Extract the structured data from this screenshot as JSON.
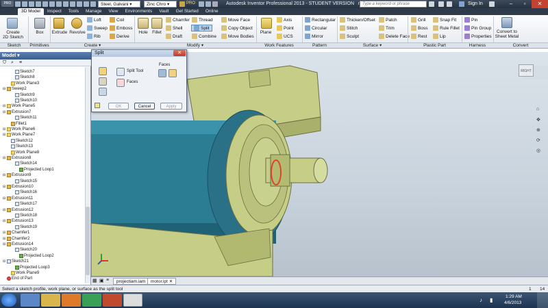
{
  "titlebar": {
    "material": "Steel, Galvani",
    "appearance": "Zinc Chro",
    "window_title": "Autodesk Inventor Professional 2013 - STUDENT VERSION",
    "file_name": "motor",
    "search_placeholder": "Type a keyword or phrase",
    "sign_in": "Sign In",
    "pro_label": "PRO"
  },
  "tabs": [
    "3D Model",
    "Inspect",
    "Tools",
    "Manage",
    "View",
    "Environments",
    "Vault",
    "Get Started",
    "Online"
  ],
  "ribbon": {
    "sketch": {
      "create_label": "Create",
      "create_sub": "2D Sketch",
      "panel": "Sketch"
    },
    "primitives": {
      "box": "Box",
      "panel": "Primitives"
    },
    "create": {
      "extrude": "Extrude",
      "revolve": "Revolve",
      "loft": "Loft",
      "sweep": "Sweep",
      "rib": "Rib",
      "coil": "Coil",
      "emboss": "Emboss",
      "derive": "Derive",
      "panel": "Create"
    },
    "modify": {
      "hole": "Hole",
      "fillet": "Fillet",
      "chamfer": "Chamfer",
      "shell": "Shell",
      "draft": "Draft",
      "thread": "Thread",
      "split": "Split",
      "combine": "Combine",
      "move_face": "Move Face",
      "copy_object": "Copy Object",
      "move_bodies": "Move Bodies",
      "panel": "Modify"
    },
    "work_features": {
      "plane": "Plane",
      "axis": "Axis",
      "point": "Point",
      "ucs": "UCS",
      "panel": "Work Features"
    },
    "pattern": {
      "rectangular": "Rectangular",
      "circular": "Circular",
      "mirror": "Mirror",
      "panel": "Pattern"
    },
    "surface": {
      "thicken": "Thicken/Offset",
      "stitch": "Stitch",
      "sculpt": "Sculpt",
      "patch": "Patch",
      "trim": "Trim",
      "delete_face": "Delete Face",
      "panel": "Surface"
    },
    "plastic_part": {
      "grill": "Grill",
      "boss": "Boss",
      "rest": "Rest",
      "snap_fit": "Snap Fit",
      "rule_fillet": "Rule Fillet",
      "lip": "Lip",
      "panel": "Plastic Part"
    },
    "harness": {
      "pin": "Pin",
      "pin_group": "Pin Group",
      "properties": "Properties",
      "panel": "Harness"
    },
    "convert": {
      "label1": "Convert to",
      "label2": "Sheet Metal",
      "panel": "Convert"
    }
  },
  "browser": {
    "title": "Model",
    "items": [
      {
        "label": "Sketch7",
        "indent": 2,
        "icon": "sketch"
      },
      {
        "label": "Sketch8",
        "indent": 2,
        "icon": "sketch"
      },
      {
        "label": "Work Plane3",
        "indent": 1,
        "icon": "wp"
      },
      {
        "label": "Sweep2",
        "indent": 0,
        "icon": "ext"
      },
      {
        "label": "Sketch9",
        "indent": 2,
        "icon": "sketch"
      },
      {
        "label": "Sketch10",
        "indent": 2,
        "icon": "sketch"
      },
      {
        "label": "Work Plane5",
        "indent": 0,
        "icon": "wp"
      },
      {
        "label": "Extrusion7",
        "indent": 0,
        "icon": "ext"
      },
      {
        "label": "Sketch11",
        "indent": 2,
        "icon": "sketch"
      },
      {
        "label": "Fillet1",
        "indent": 1,
        "icon": "fil"
      },
      {
        "label": "Work Plane6",
        "indent": 0,
        "icon": "wp"
      },
      {
        "label": "Work Plane7",
        "indent": 0,
        "icon": "wp"
      },
      {
        "label": "Sketch12",
        "indent": 1,
        "icon": "sketch"
      },
      {
        "label": "Sketch13",
        "indent": 1,
        "icon": "sketch"
      },
      {
        "label": "Work Plane8",
        "indent": 1,
        "icon": "wp"
      },
      {
        "label": "Extrusion8",
        "indent": 0,
        "icon": "ext"
      },
      {
        "label": "Sketch14",
        "indent": 2,
        "icon": "sketch"
      },
      {
        "label": "Projected Loop1",
        "indent": 3,
        "icon": "proj"
      },
      {
        "label": "Extrusion9",
        "indent": 0,
        "icon": "ext"
      },
      {
        "label": "Sketch15",
        "indent": 2,
        "icon": "sketch"
      },
      {
        "label": "Extrusion10",
        "indent": 0,
        "icon": "ext"
      },
      {
        "label": "Sketch16",
        "indent": 2,
        "icon": "sketch"
      },
      {
        "label": "Extrusion11",
        "indent": 0,
        "icon": "ext"
      },
      {
        "label": "Sketch17",
        "indent": 2,
        "icon": "sketch"
      },
      {
        "label": "Extrusion12",
        "indent": 0,
        "icon": "ext"
      },
      {
        "label": "Sketch18",
        "indent": 2,
        "icon": "sketch"
      },
      {
        "label": "Extrusion13",
        "indent": 0,
        "icon": "ext"
      },
      {
        "label": "Sketch19",
        "indent": 2,
        "icon": "sketch"
      },
      {
        "label": "Chamfer1",
        "indent": 0,
        "icon": "fil"
      },
      {
        "label": "Chamfer2",
        "indent": 0,
        "icon": "fil"
      },
      {
        "label": "Extrusion14",
        "indent": 0,
        "icon": "ext"
      },
      {
        "label": "Sketch20",
        "indent": 2,
        "icon": "sketch"
      },
      {
        "label": "Projected Loop2",
        "indent": 3,
        "icon": "proj"
      },
      {
        "label": "Sketch21",
        "indent": 0,
        "icon": "sketch"
      },
      {
        "label": "Projected Loop3",
        "indent": 2,
        "icon": "proj"
      },
      {
        "label": "Work Plane9",
        "indent": 1,
        "icon": "wp"
      },
      {
        "label": "End of Part",
        "indent": 0,
        "icon": "eop"
      }
    ]
  },
  "dialog": {
    "title": "Split",
    "split_tool": "Split Tool",
    "faces_label": "Faces",
    "faces_group": "Faces",
    "ok": "OK",
    "cancel": "Cancel",
    "apply": "Apply"
  },
  "viewcube": {
    "label": "RIGHT"
  },
  "doc_tabs": [
    "projectiam.iam",
    "motor.ipt"
  ],
  "status": {
    "prompt": "Select a sketch profile, work plane, or surface as the split tool",
    "num1": "1",
    "num2": "14"
  },
  "taskbar": {
    "time": "1:29 AM",
    "date": "4/6/2013"
  },
  "colors": {
    "model_body": "#c8d08a",
    "motor_teal": "#2e7f95",
    "highlight": "#e0442a"
  }
}
